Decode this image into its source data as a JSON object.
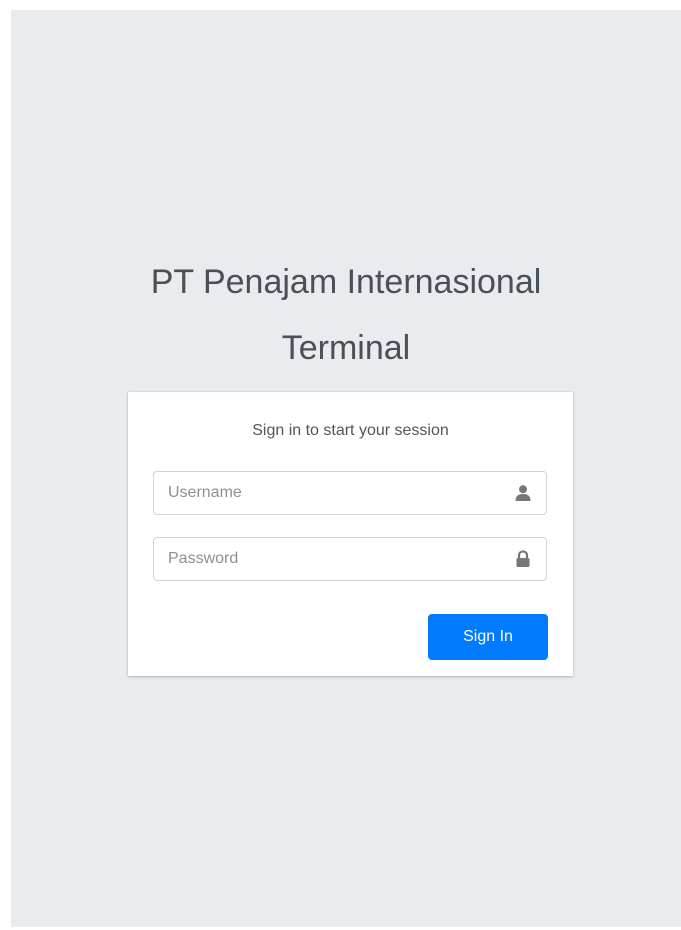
{
  "brand": {
    "line1": "PT Penajam Internasional",
    "line2": "Terminal"
  },
  "login": {
    "message": "Sign in to start your session",
    "username": {
      "placeholder": "Username",
      "value": "",
      "icon": "user-icon"
    },
    "password": {
      "placeholder": "Password",
      "value": "",
      "icon": "lock-icon"
    },
    "submit_label": "Sign In"
  },
  "colors": {
    "background": "#e9ecef",
    "card": "#ffffff",
    "primary": "#007bff",
    "icon": "#777777"
  }
}
